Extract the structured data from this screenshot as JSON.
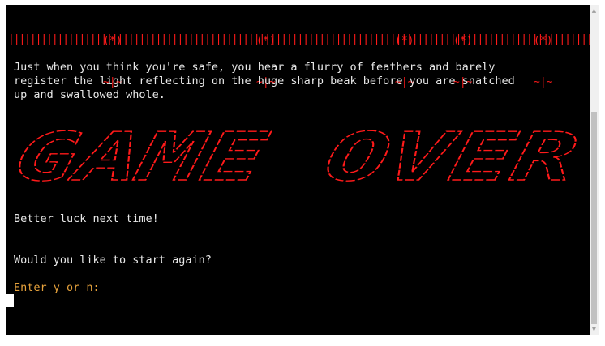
{
  "flowers": [
    {
      "top": "(*)",
      "stem": "~|~"
    },
    {
      "top": "(*)",
      "stem": "~|~"
    },
    {
      "top": "(*)",
      "stem": "~|~"
    },
    {
      "top": "(*)",
      "stem": "~|~"
    },
    {
      "top": "(*)",
      "stem": "~|~"
    }
  ],
  "fence": "||||||||||||||||||||||||||||||||||||||||||||||||||||||||||||||||||||||||||||||||||||||||||||||||||||||||||||||||||||||||||||||||||||||||",
  "story": {
    "line1": "Just when you think you're safe, you hear a flurry of feathers and barely",
    "line2": "register the light reflecting on the huge sharp beak before you are snatched",
    "line3": "up and swallowed whole."
  },
  "banner": {
    "text": "GAME OVER",
    "color": "#ff1a1a"
  },
  "messages": {
    "better_luck": "Better luck next time!",
    "start_again": "Would you like to start again?",
    "prompt": "Enter y or n:"
  },
  "colors": {
    "background": "#000000",
    "text": "#e8e8e8",
    "accent_red": "#ff1a1a",
    "prompt_orange": "#e6a23c"
  }
}
